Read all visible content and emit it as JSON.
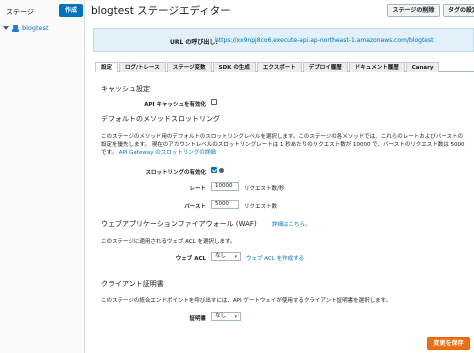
{
  "sidebar": {
    "header": "ステージ",
    "create_label": "作成",
    "items": [
      {
        "label": "blogtest"
      }
    ]
  },
  "header": {
    "title": "blogtest ステージエディター",
    "delete_label": "ステージの削除",
    "tag_label": "タグの設定"
  },
  "url_banner": {
    "label": "URL の呼び出し:",
    "url": "https://xx9npj8co6.execute-api.ap-northeast-1.amazonaws.com/blogtest"
  },
  "tabs": [
    {
      "label": "設定",
      "active": true
    },
    {
      "label": "ログ/トレース",
      "active": false
    },
    {
      "label": "ステージ変数",
      "active": false
    },
    {
      "label": "SDK の生成",
      "active": false
    },
    {
      "label": "エクスポート",
      "active": false
    },
    {
      "label": "デプロイ履歴",
      "active": false
    },
    {
      "label": "ドキュメント履歴",
      "active": false
    },
    {
      "label": "Canary",
      "active": false
    }
  ],
  "cache": {
    "title": "キャッシュ設定",
    "enable_label": "API キャッシュを有効化",
    "enabled": false
  },
  "throttling": {
    "title": "デフォルトのメソッドスロットリング",
    "description": "このステージのメソッド用のデフォルトのスロットリングレベルを選択します。このステージの各メソッドでは、これらのレートおよびバーストの設定を優先します。 現在のアカウントレベルのスロットリングレートは 1 秒あたりのリクエスト数が 10000 で、バーストのリクエスト数は 5000 です。",
    "link_text": "API Gateway のスロットリングの詳細",
    "enable_label": "スロットリングの有効化",
    "enabled": true,
    "rate_label": "レート",
    "rate_value": "10000",
    "rate_unit": "リクエスト数/秒",
    "burst_label": "バースト",
    "burst_value": "5000",
    "burst_unit": "リクエスト数"
  },
  "waf": {
    "title": "ウェブアプリケーションファイアウォール (WAF)",
    "details_link": "詳細はこちら。",
    "description": "このステージに適用されるウェブ ACL を選択します。",
    "acl_label": "ウェブ ACL",
    "acl_value": "なし",
    "create_link": "ウェブ ACL を作成する"
  },
  "client_cert": {
    "title": "クライアント証明書",
    "description": "このステージの統合エンドポイントを呼び出すには、API ゲートウェイが使用するクライアント証明書を選択します。",
    "cert_label": "証明書",
    "cert_value": "なし"
  },
  "footer": {
    "save_label": "変更を保存"
  },
  "colors": {
    "primary": "#0073bb",
    "save": "#ec7211",
    "banner": "#e1f0f9"
  }
}
